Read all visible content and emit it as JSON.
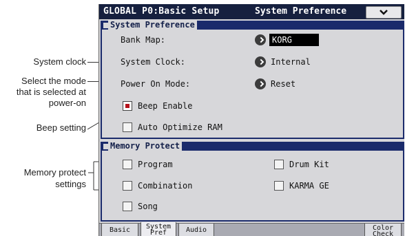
{
  "callouts": {
    "system_clock": "System clock",
    "power_on_l1": "Select the mode",
    "power_on_l2": "that is selected at",
    "power_on_l3": "power-on",
    "beep": "Beep setting",
    "mem_l1": "Memory protect",
    "mem_l2": "settings"
  },
  "header": {
    "title": "GLOBAL P0:Basic Setup",
    "page": "System Preference",
    "menu_icon": "chevron-down-icon"
  },
  "system_pref": {
    "heading": "System Preference",
    "bank_map_label": "Bank Map:",
    "bank_map_value": "KORG",
    "system_clock_label": "System Clock:",
    "system_clock_value": "Internal",
    "power_on_label": "Power On Mode:",
    "power_on_value": "Reset",
    "beep_label": "Beep Enable",
    "beep_checked": true,
    "auto_opt_label": "Auto Optimize RAM",
    "auto_opt_checked": false
  },
  "memory_protect": {
    "heading": "Memory Protect",
    "program": "Program",
    "combination": "Combination",
    "song": "Song",
    "drum_kit": "Drum Kit",
    "karma_ge": "KARMA GE"
  },
  "tabs": {
    "basic": "Basic",
    "sysref_l1": "System",
    "sysref_l2": "Pref",
    "audio": "Audio",
    "color_l1": "Color",
    "color_l2": "Check"
  },
  "colors": {
    "title_bg": "#16203f",
    "panel_header": "#1a2a6b",
    "screen_bg": "#d7d7da",
    "check_mark": "#b5121b"
  }
}
